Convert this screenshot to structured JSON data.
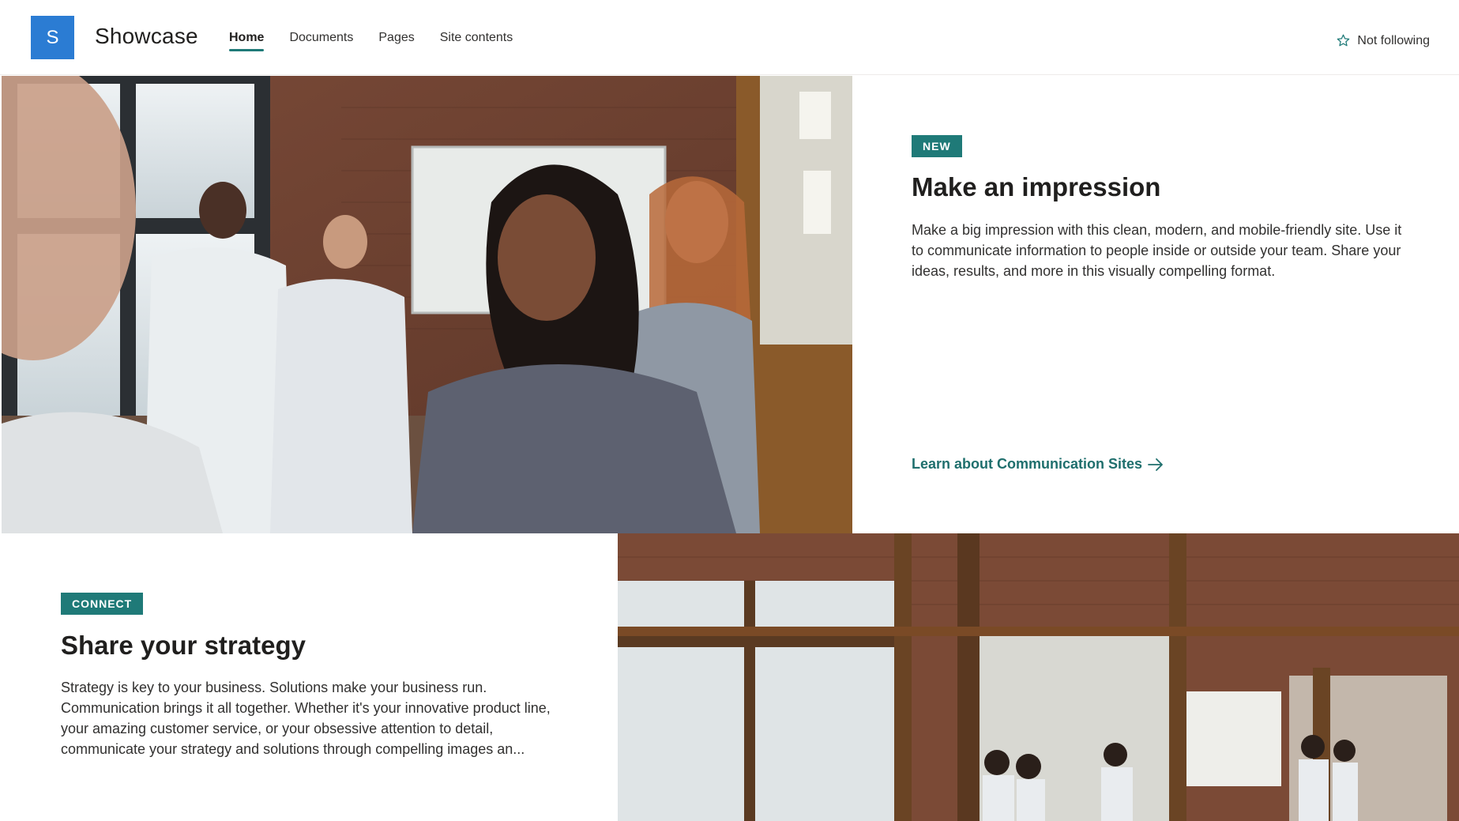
{
  "site": {
    "logo_letter": "S",
    "title": "Showcase"
  },
  "nav": {
    "items": [
      {
        "label": "Home",
        "active": true
      },
      {
        "label": "Documents",
        "active": false
      },
      {
        "label": "Pages",
        "active": false
      },
      {
        "label": "Site contents",
        "active": false
      }
    ]
  },
  "follow": {
    "label": "Not following",
    "icon": "star-outline-icon"
  },
  "hero": {
    "tile1": {
      "badge": "NEW",
      "title": "Make an impression",
      "body": "Make a big impression with this clean, modern, and mobile-friendly site. Use it to communicate information to people inside or outside your team. Share your ideas, results, and more in this visually compelling format.",
      "link": "Learn about Communication Sites"
    },
    "tile2": {
      "badge": "CONNECT",
      "title": "Share your strategy",
      "body": "Strategy is key to your business. Solutions make your business run. Communication brings it all together. Whether it's your innovative product line, your amazing customer service, or your obsessive attention to detail, communicate your strategy and solutions through compelling images an..."
    }
  },
  "colors": {
    "accent": "#1f7a78",
    "logo": "#2b7cd3"
  }
}
